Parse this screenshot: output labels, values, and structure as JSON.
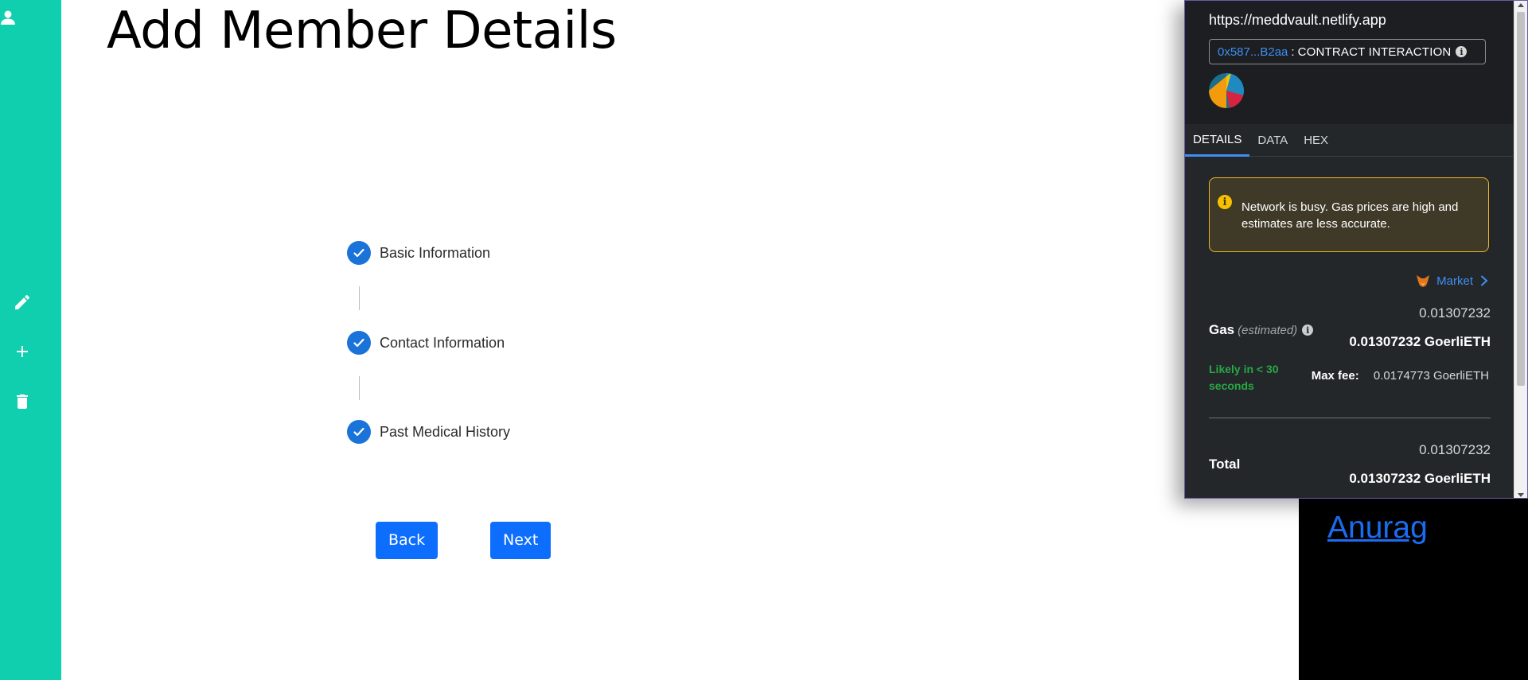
{
  "sidebar": {
    "icons": [
      "user-icon",
      "pencil-icon",
      "plus-icon",
      "trash-icon"
    ],
    "color": "#0fcfaf"
  },
  "page": {
    "title": "Add Member Details"
  },
  "stepper": {
    "steps": [
      {
        "label": "Basic Information",
        "completed": true
      },
      {
        "label": "Contact Information",
        "completed": true
      },
      {
        "label": "Past Medical History",
        "completed": true
      }
    ],
    "accent": "#1a73d9"
  },
  "buttons": {
    "back_label": "Back",
    "next_label": "Next",
    "color": "#0d6efd"
  },
  "user_panel": {
    "name": "Anurag"
  },
  "wallet": {
    "origin": "https://meddvault.netlify.app",
    "contract_address": "0x587...B2aa",
    "separator": ":",
    "interaction_type": "CONTRACT INTERACTION",
    "tabs": [
      "DETAILS",
      "DATA",
      "HEX"
    ],
    "active_tab": "DETAILS",
    "warning": "Network is busy. Gas prices are high and estimates are less accurate.",
    "market_label": "Market",
    "gas": {
      "label": "Gas",
      "qualifier": "(estimated)",
      "value": "0.01307232",
      "value_with_unit": "0.01307232 GoerliETH"
    },
    "likely": "Likely in < 30 seconds",
    "max_fee": {
      "label": "Max fee:",
      "value": "0.0174773 GoerliETH"
    },
    "total": {
      "label": "Total",
      "value": "0.01307232",
      "value_with_unit": "0.01307232 GoerliETH"
    },
    "colors": {
      "link": "#3e8ff2",
      "warning_border": "#f0b429",
      "success": "#28a745"
    }
  }
}
